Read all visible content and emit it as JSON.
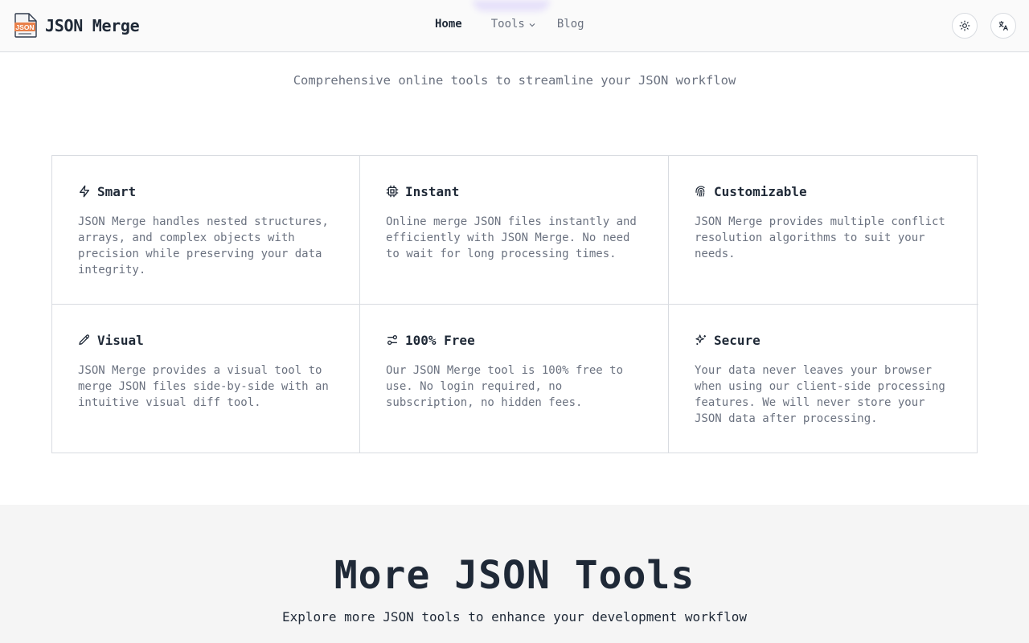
{
  "header": {
    "brand": "JSON Merge",
    "logo_text": "JSON",
    "nav": [
      {
        "label": "Home"
      },
      {
        "label": "Tools"
      },
      {
        "label": "Blog"
      }
    ],
    "theme_icon": "sun-icon",
    "language_icon": "translate-icon"
  },
  "hero": {
    "subtitle": "Comprehensive online tools to streamline your JSON workflow"
  },
  "features": [
    {
      "icon": "zap-icon",
      "title": "Smart",
      "desc": "JSON Merge handles nested structures, arrays, and complex objects with precision while preserving your data integrity."
    },
    {
      "icon": "cpu-icon",
      "title": "Instant",
      "desc": "Online merge JSON files instantly and efficiently with JSON Merge. No need to wait for long processing times."
    },
    {
      "icon": "fingerprint-icon",
      "title": "Customizable",
      "desc": "JSON Merge provides multiple conflict resolution algorithms to suit your needs."
    },
    {
      "icon": "pencil-icon",
      "title": "Visual",
      "desc": "JSON Merge provides a visual tool to merge JSON files side-by-side with an intuitive visual diff tool."
    },
    {
      "icon": "sliders-icon",
      "title": "100% Free",
      "desc": "Our JSON Merge tool is 100% free to use. No login required, no subscription, no hidden fees."
    },
    {
      "icon": "sparkles-icon",
      "title": "Secure",
      "desc": "Your data never leaves your browser when using our client-side processing features. We will never store your JSON data after processing."
    }
  ],
  "more_tools": {
    "title": "More JSON Tools",
    "subtitle": "Explore more JSON tools to enhance your development workflow"
  },
  "colors": {
    "text": "#1f2937",
    "muted": "#6b7280",
    "border": "#d9dce1",
    "logo_accent": "#e8804a",
    "section_bg": "#f5f5f5"
  }
}
